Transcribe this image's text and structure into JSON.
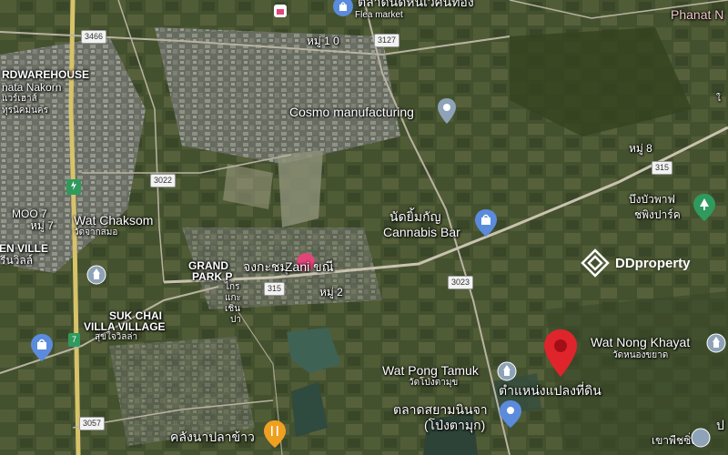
{
  "map": {
    "colors": {
      "satellite_base": "#3d4a2c",
      "urban": "#7d7f78",
      "water": "#3e6355",
      "road_major": "#d8c36a",
      "road_minor": "#b9b3a2",
      "pin_red": "#e0242c",
      "poi_blue": "#5b8bdc",
      "poi_green": "#2f9a5d",
      "poi_orange": "#f0a020",
      "poi_pink": "#e2457a"
    },
    "labels": {
      "flea_market_thai": "ตลาดนัดหนิเวศน์ทอง",
      "flea_market": "Flea market",
      "phanat_n": "Phanat N",
      "warehouse_1": "RDWAREHOUSE",
      "warehouse_2": "nata Nakorn",
      "warehouse_3": "แวร์เฮาส์",
      "warehouse_4": "ทุรนิคมนคร",
      "moo10": "หมู่ 1 0",
      "cosmo": "Cosmo manufacturing",
      "moo8": "หมู่ 8",
      "cannabis_thai": "นัดยิ้มกัญ",
      "cannabis": "Cannabis Bar",
      "bueng_1": "บึงบัวพาฟ",
      "bueng_2": "ชพิงปาร์ค",
      "moo7_en": "MOO 7",
      "moo7_th": "หมู่ 7",
      "wat_chaksom": "Wat Chaksom",
      "wat_chaksom_th": "วัดจากสมอ",
      "en_ville": "EN VILLE",
      "en_ville_th": "รีนวิลล์",
      "grand_1": "GRAND",
      "grand_2": "PARK P",
      "grand_th_1": "ไกร",
      "grand_th_2": "แกะ",
      "grand_th_3": "เชิน",
      "grand_th_4": "ปา",
      "zani_th": "จงกะชมุ",
      "zani": "Zani ขณี",
      "moo2": "หมู่ 2",
      "sukchai_1": "SUK CHAI",
      "sukchai_2": "VILLA VILLAGE",
      "sukchai_th": "สุขใจวิลล่า",
      "wat_nong": "Wat Nong Khayat",
      "wat_nong_th": "วัดหนองขยาด",
      "wat_pong": "Wat Pong Tamuk",
      "wat_pong_th": "วัดโป่งตามุข",
      "pin_label": "ตำแหน่งแปลงที่ดิน",
      "market_1": "ตลาดสยามนินจา",
      "market_2": "(โป่งตามุก)",
      "klang": "คลังนาปลาข้าว",
      "khao": "เขาพืชซิ่ง",
      "right_edge_top": "ใ",
      "right_edge_bottom": "ป"
    },
    "shields": {
      "r3466": "3466",
      "r3127": "3127",
      "r315a": "315",
      "r3022": "3022",
      "r315b": "315",
      "r3023": "3023",
      "r7a": "7",
      "r7b": "7",
      "r3057": "3057"
    },
    "watermark": "DDproperty",
    "icons": {
      "poi": "map-pin-icon",
      "shopping": "shopping-bag-icon",
      "restaurant": "fork-knife-icon",
      "temple": "temple-icon",
      "park": "park-icon",
      "location": "location-pin-icon"
    }
  }
}
